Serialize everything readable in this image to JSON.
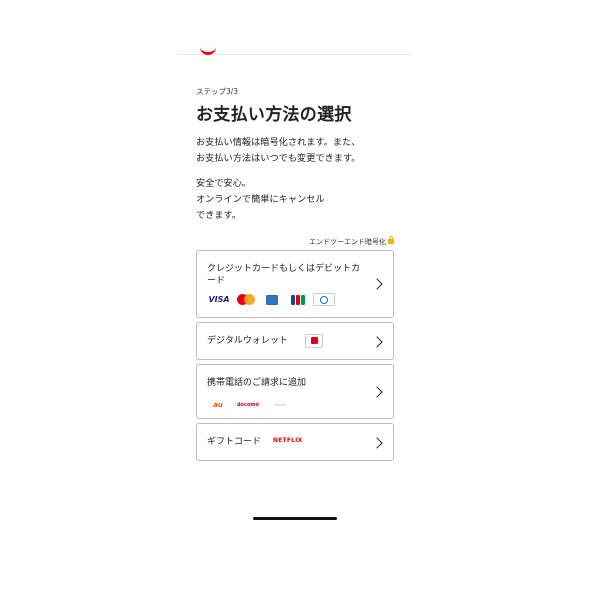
{
  "step": "ステップ3/3",
  "title": "お支払い方法の選択",
  "intro_lines": [
    "お支払い情報は暗号化されます。また、",
    "お支払い方法はいつでも変更できます。"
  ],
  "safety_lines": [
    "安全で安心。",
    "オンラインで簡単にキャンセル",
    "できます。"
  ],
  "encryption_note": "エンドツーエンド暗号化",
  "options": [
    {
      "label": "クレジットカードもしくはデビットカード",
      "icons": [
        "visa-logo",
        "mastercard-logo",
        "amex-logo",
        "jcb-logo",
        "diners-club-logo"
      ],
      "visa_text": "VISA"
    },
    {
      "label": "デジタルウォレット",
      "icons": [
        "paypay-logo"
      ]
    },
    {
      "label": "携帯電話のご請求に追加",
      "icons": [
        "au-logo",
        "docomo-logo",
        "softbank-logo"
      ],
      "au_text": "au",
      "docomo_text": "docomo"
    },
    {
      "label": "ギフトコード",
      "icons": [
        "netflix-logo"
      ],
      "netflix_text": "NETFLIX"
    }
  ],
  "colors": {
    "accent": "#e50914",
    "border": "#bdbdbd",
    "text": "#222222",
    "lock": "#f0b400"
  }
}
